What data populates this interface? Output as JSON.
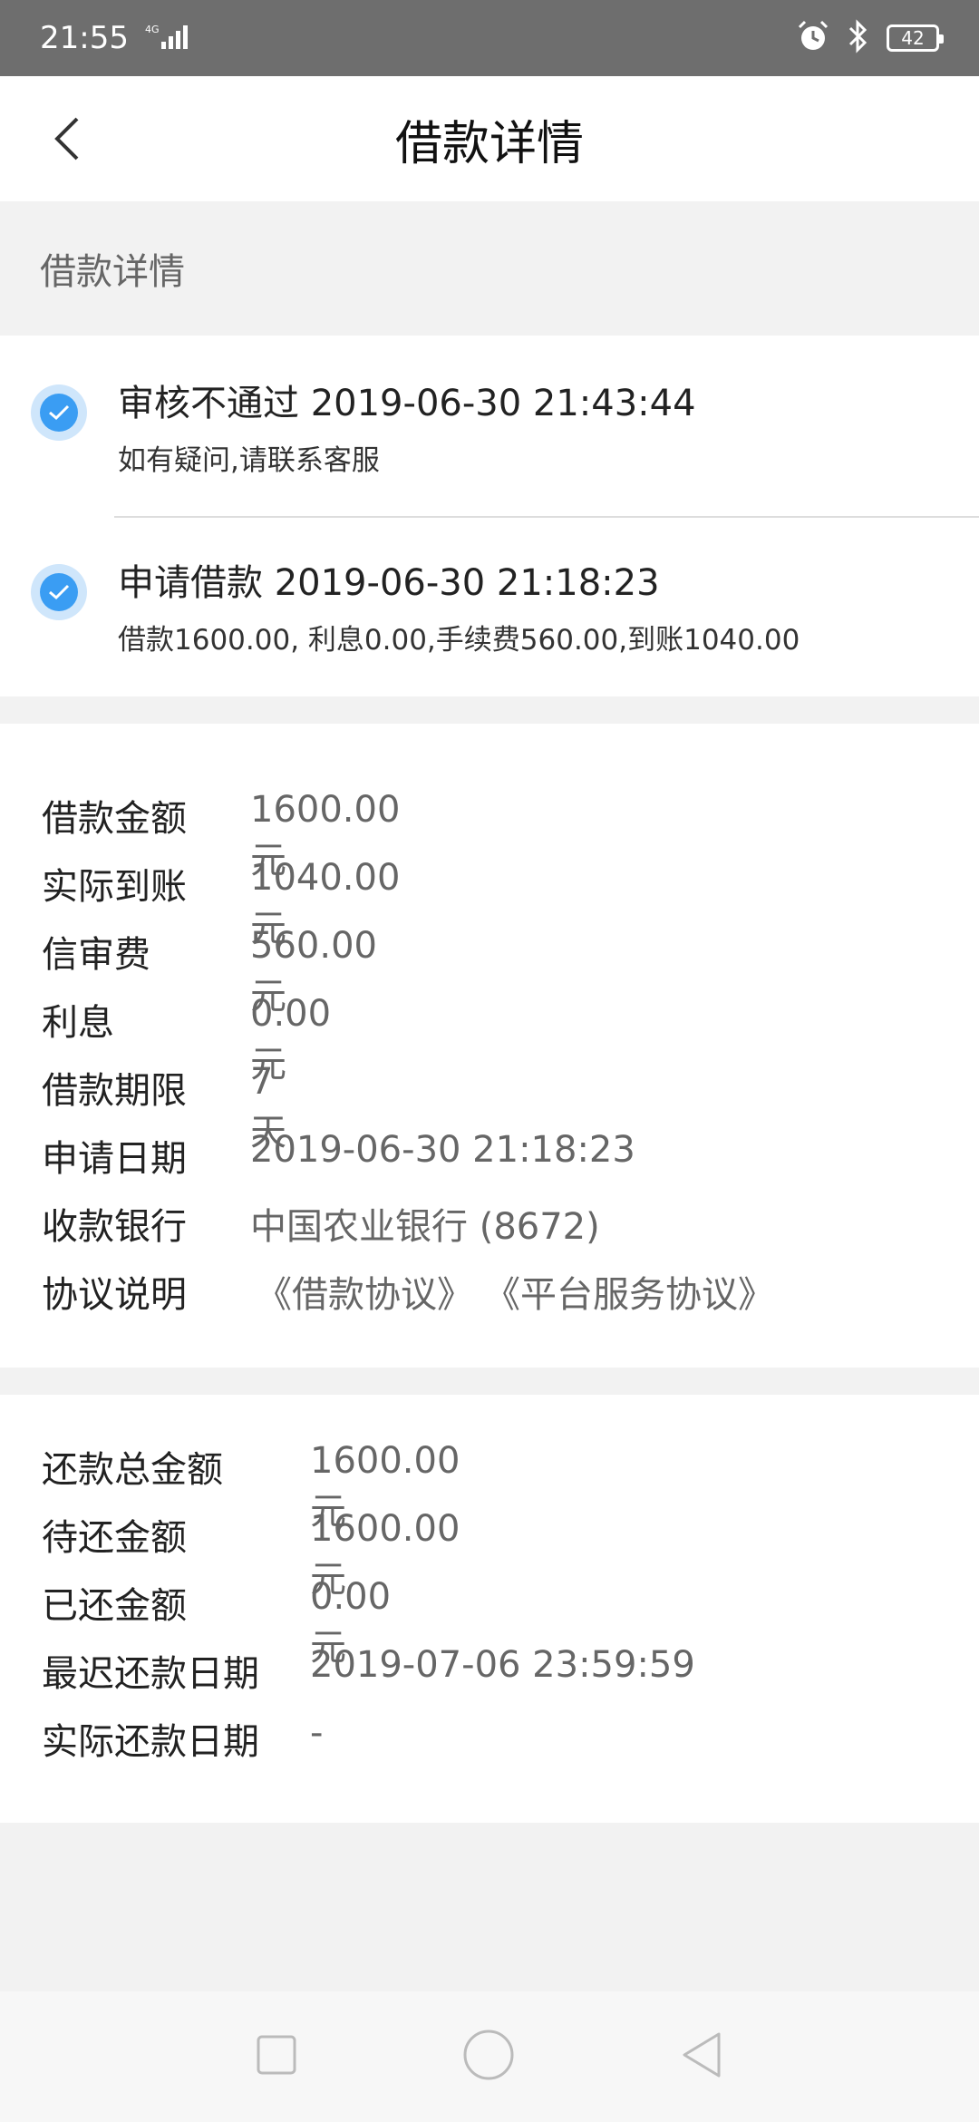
{
  "status_bar": {
    "time": "21:55",
    "network": "4G",
    "battery": "42",
    "icons": [
      "signal-icon",
      "alarm-icon",
      "bluetooth-icon",
      "battery-icon"
    ]
  },
  "header": {
    "title": "借款详情",
    "back_icon": "back-arrow-icon"
  },
  "section_header": "借款详情",
  "timeline": [
    {
      "title": "审核不通过 2019-06-30 21:43:44",
      "subtitle": "如有疑问,请联系客服"
    },
    {
      "title": "申请借款 2019-06-30 21:18:23",
      "subtitle": "借款1600.00, 利息0.00,手续费560.00,到账1040.00"
    }
  ],
  "loan_details": [
    {
      "label": "借款金额",
      "value": "1600.00元"
    },
    {
      "label": "实际到账",
      "value": "1040.00元"
    },
    {
      "label": "信审费",
      "value": "560.00元"
    },
    {
      "label": "利息",
      "value": "0.00元"
    },
    {
      "label": "借款期限",
      "value": "7天"
    },
    {
      "label": "申请日期",
      "value": "2019-06-30 21:18:23"
    },
    {
      "label": "收款银行",
      "value": "中国农业银行 (8672)"
    },
    {
      "label": "协议说明",
      "links": [
        "《借款协议》",
        "《平台服务协议》"
      ]
    }
  ],
  "repayment_details": [
    {
      "label": "还款总金额",
      "value": "1600.00元"
    },
    {
      "label": "待还金额",
      "value": "1600.00元"
    },
    {
      "label": "已还金额",
      "value": "0.00元"
    },
    {
      "label": "最迟还款日期",
      "value": "2019-07-06 23:59:59"
    },
    {
      "label": "实际还款日期",
      "value": "-"
    }
  ],
  "colors": {
    "accent": "#3a9df3",
    "link": "#2a98e8",
    "status_bar": "#6e6e6e",
    "background": "#f2f2f2"
  }
}
